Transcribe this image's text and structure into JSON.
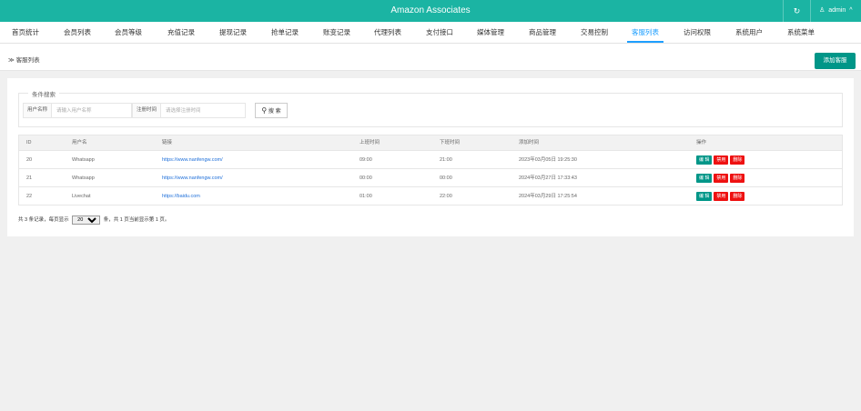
{
  "header": {
    "title": "Amazon Associates",
    "refresh_icon": "refresh-icon",
    "refresh_glyph": "↻",
    "user_glyph": "♙",
    "user_label": "admin",
    "caret_glyph": "^"
  },
  "nav": {
    "active_color": "#1e9fff",
    "items": [
      {
        "label": "首页统计"
      },
      {
        "label": "会员列表"
      },
      {
        "label": "会员等级"
      },
      {
        "label": "充值记录"
      },
      {
        "label": "提现记录"
      },
      {
        "label": "抢单记录"
      },
      {
        "label": "账变记录"
      },
      {
        "label": "代理列表"
      },
      {
        "label": "支付接口"
      },
      {
        "label": "媒体管理"
      },
      {
        "label": "商品管理"
      },
      {
        "label": "交易控制"
      },
      {
        "label": "客服列表"
      },
      {
        "label": "访问权限"
      },
      {
        "label": "系统用户"
      },
      {
        "label": "系统菜单"
      }
    ]
  },
  "breadcrumb": {
    "prefix": "≫",
    "label": "客服列表"
  },
  "actions": {
    "add_label": "添加客服"
  },
  "search": {
    "legend": "条件搜索",
    "username_label": "用户名称",
    "username_placeholder": "请输入用户名称",
    "regtime_label": "注册时间",
    "regtime_placeholder": "请选择注册时间",
    "search_glyph": "⚲",
    "search_label": "搜 索"
  },
  "table": {
    "headers": [
      "ID",
      "用户名",
      "链接",
      "上班时间",
      "下班时间",
      "添加时间",
      "操作"
    ],
    "rows": [
      {
        "id": "20",
        "username": "Whatsapp",
        "link": "https://www.nanfengw.com/",
        "start": "09:00",
        "end": "21:00",
        "added": "2023年03月05日 19:25:30"
      },
      {
        "id": "21",
        "username": "Whatsapp",
        "link": "https://www.nanfengw.com/",
        "start": "00:00",
        "end": "00:00",
        "added": "2024年03月27日 17:33:43"
      },
      {
        "id": "22",
        "username": "Livechat",
        "link": "https://baidu.com",
        "start": "01:00",
        "end": "22:00",
        "added": "2024年03月29日 17:25:54"
      }
    ],
    "ops": {
      "edit": "编 辑",
      "disable": "禁用",
      "delete": "删除"
    }
  },
  "pager": {
    "prefix": "共 3 条记录，每页显示",
    "page_size": "20",
    "suffix": "条，共 1 页当前显示第 1 页。"
  }
}
